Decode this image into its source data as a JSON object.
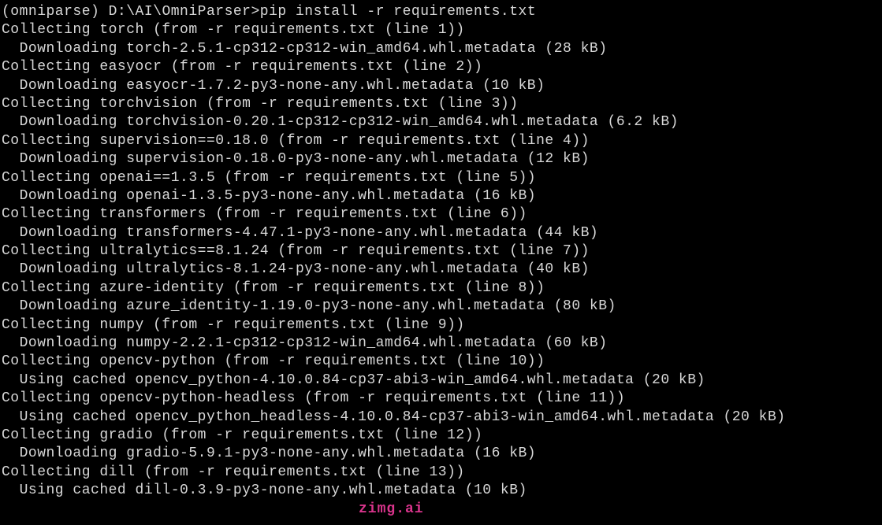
{
  "prompt": {
    "env": "(omniparse)",
    "path": "D:\\AI\\OmniParser>",
    "command": "pip install -r requirements.txt"
  },
  "lines": [
    "Collecting torch (from -r requirements.txt (line 1))",
    "  Downloading torch-2.5.1-cp312-cp312-win_amd64.whl.metadata (28 kB)",
    "Collecting easyocr (from -r requirements.txt (line 2))",
    "  Downloading easyocr-1.7.2-py3-none-any.whl.metadata (10 kB)",
    "Collecting torchvision (from -r requirements.txt (line 3))",
    "  Downloading torchvision-0.20.1-cp312-cp312-win_amd64.whl.metadata (6.2 kB)",
    "Collecting supervision==0.18.0 (from -r requirements.txt (line 4))",
    "  Downloading supervision-0.18.0-py3-none-any.whl.metadata (12 kB)",
    "Collecting openai==1.3.5 (from -r requirements.txt (line 5))",
    "  Downloading openai-1.3.5-py3-none-any.whl.metadata (16 kB)",
    "Collecting transformers (from -r requirements.txt (line 6))",
    "  Downloading transformers-4.47.1-py3-none-any.whl.metadata (44 kB)",
    "Collecting ultralytics==8.1.24 (from -r requirements.txt (line 7))",
    "  Downloading ultralytics-8.1.24-py3-none-any.whl.metadata (40 kB)",
    "Collecting azure-identity (from -r requirements.txt (line 8))",
    "  Downloading azure_identity-1.19.0-py3-none-any.whl.metadata (80 kB)",
    "Collecting numpy (from -r requirements.txt (line 9))",
    "  Downloading numpy-2.2.1-cp312-cp312-win_amd64.whl.metadata (60 kB)",
    "Collecting opencv-python (from -r requirements.txt (line 10))",
    "  Using cached opencv_python-4.10.0.84-cp37-abi3-win_amd64.whl.metadata (20 kB)",
    "Collecting opencv-python-headless (from -r requirements.txt (line 11))",
    "  Using cached opencv_python_headless-4.10.0.84-cp37-abi3-win_amd64.whl.metadata (20 kB)",
    "Collecting gradio (from -r requirements.txt (line 12))",
    "  Downloading gradio-5.9.1-py3-none-any.whl.metadata (16 kB)",
    "Collecting dill (from -r requirements.txt (line 13))",
    "  Using cached dill-0.3.9-py3-none-any.whl.metadata (10 kB)"
  ],
  "watermark": "zimg.ai"
}
